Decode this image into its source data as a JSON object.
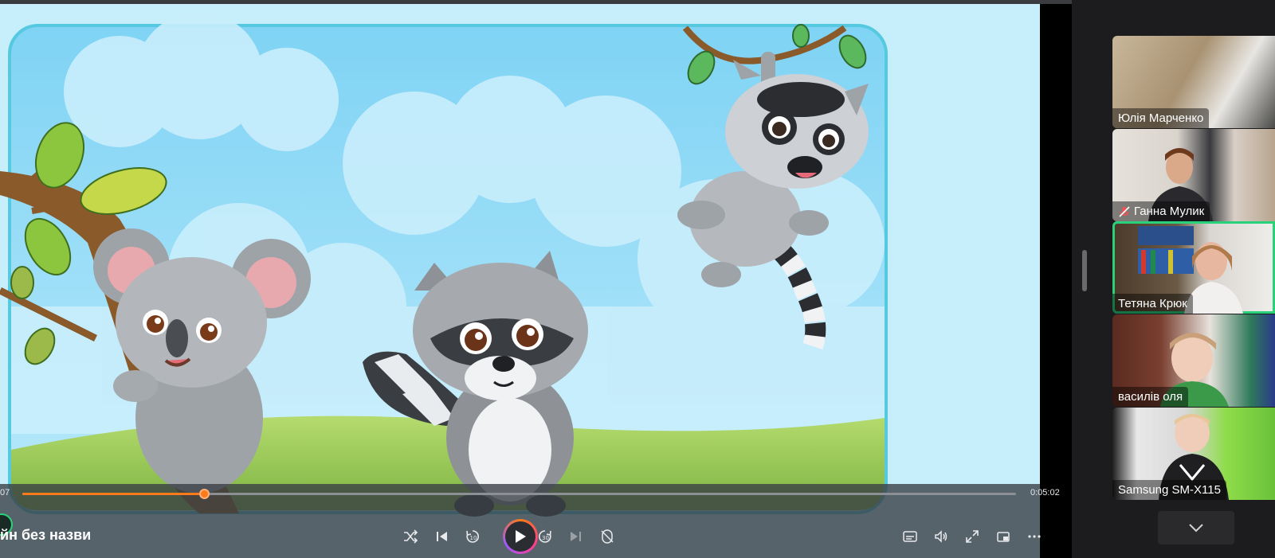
{
  "player": {
    "current_time": "07",
    "total_time": "0:05:02",
    "progress_fraction": 0.183,
    "file_title": "йн без назви",
    "accent_color": "#ff7a1a"
  },
  "controls": [
    {
      "name": "shuffle-icon"
    },
    {
      "name": "previous-icon"
    },
    {
      "name": "rewind-10-icon",
      "label": "10"
    },
    {
      "name": "play-icon"
    },
    {
      "name": "forward-30-icon",
      "label": "30"
    },
    {
      "name": "next-icon"
    },
    {
      "name": "repeat-off-icon"
    },
    {
      "name": "captions-icon"
    },
    {
      "name": "volume-icon"
    },
    {
      "name": "fullscreen-icon"
    },
    {
      "name": "miniplayer-icon"
    },
    {
      "name": "more-icon"
    }
  ],
  "participants": [
    {
      "name": "Юлія Марченко",
      "muted": false,
      "active": false
    },
    {
      "name": "Ганна Мулик",
      "muted": true,
      "active": false
    },
    {
      "name": "Тетяна Крюк",
      "muted": false,
      "active": true
    },
    {
      "name": "василів оля",
      "muted": false,
      "active": false
    },
    {
      "name": "Samsung SM-X115",
      "muted": false,
      "active": false
    }
  ],
  "colors": {
    "active_speaker": "#29d17a",
    "muted_icon": "#ff4d4f"
  }
}
